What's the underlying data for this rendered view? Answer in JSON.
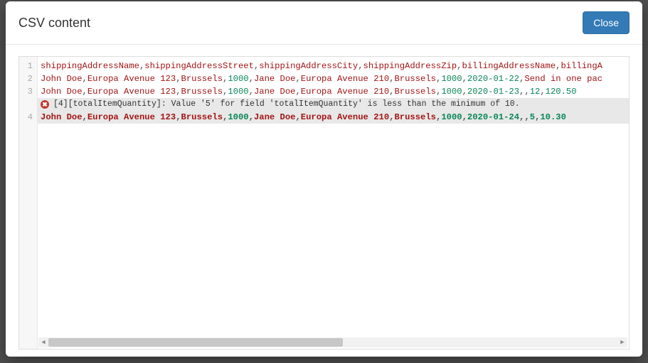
{
  "modal": {
    "title": "CSV content",
    "close_label": "Close"
  },
  "editor": {
    "lines": [
      {
        "n": 1,
        "kind": "text",
        "tokens": [
          {
            "t": "id",
            "v": "shippingAddressName"
          },
          {
            "t": "c",
            "v": ","
          },
          {
            "t": "id",
            "v": "shippingAddressStreet"
          },
          {
            "t": "c",
            "v": ","
          },
          {
            "t": "id",
            "v": "shippingAddressCity"
          },
          {
            "t": "c",
            "v": ","
          },
          {
            "t": "id",
            "v": "shippingAddressZip"
          },
          {
            "t": "c",
            "v": ","
          },
          {
            "t": "id",
            "v": "billingAddressName"
          },
          {
            "t": "c",
            "v": ","
          },
          {
            "t": "id",
            "v": "billingA"
          }
        ]
      },
      {
        "n": 2,
        "kind": "text",
        "tokens": [
          {
            "t": "str",
            "v": "John Doe"
          },
          {
            "t": "c",
            "v": ","
          },
          {
            "t": "str",
            "v": "Europa Avenue 123"
          },
          {
            "t": "c",
            "v": ","
          },
          {
            "t": "str",
            "v": "Brussels"
          },
          {
            "t": "c",
            "v": ","
          },
          {
            "t": "num",
            "v": "1000"
          },
          {
            "t": "c",
            "v": ","
          },
          {
            "t": "str",
            "v": "Jane Doe"
          },
          {
            "t": "c",
            "v": ","
          },
          {
            "t": "str",
            "v": "Europa Avenue 210"
          },
          {
            "t": "c",
            "v": ","
          },
          {
            "t": "str",
            "v": "Brussels"
          },
          {
            "t": "c",
            "v": ","
          },
          {
            "t": "num",
            "v": "1000"
          },
          {
            "t": "c",
            "v": ","
          },
          {
            "t": "num",
            "v": "2020-01-22"
          },
          {
            "t": "c",
            "v": ","
          },
          {
            "t": "str",
            "v": "Send in one pac"
          }
        ]
      },
      {
        "n": 3,
        "kind": "text",
        "tokens": [
          {
            "t": "str",
            "v": "John Doe"
          },
          {
            "t": "c",
            "v": ","
          },
          {
            "t": "str",
            "v": "Europa Avenue 123"
          },
          {
            "t": "c",
            "v": ","
          },
          {
            "t": "str",
            "v": "Brussels"
          },
          {
            "t": "c",
            "v": ","
          },
          {
            "t": "num",
            "v": "1000"
          },
          {
            "t": "c",
            "v": ","
          },
          {
            "t": "str",
            "v": "Jane Doe"
          },
          {
            "t": "c",
            "v": ","
          },
          {
            "t": "str",
            "v": "Europa Avenue 210"
          },
          {
            "t": "c",
            "v": ","
          },
          {
            "t": "str",
            "v": "Brussels"
          },
          {
            "t": "c",
            "v": ","
          },
          {
            "t": "num",
            "v": "1000"
          },
          {
            "t": "c",
            "v": ","
          },
          {
            "t": "num",
            "v": "2020-01-23"
          },
          {
            "t": "c",
            "v": ","
          },
          {
            "t": "c",
            "v": ","
          },
          {
            "t": "num",
            "v": "12"
          },
          {
            "t": "c",
            "v": ","
          },
          {
            "t": "num",
            "v": "120.50"
          }
        ]
      },
      {
        "kind": "error",
        "message": "[4][totalItemQuantity]: Value '5' for field 'totalItemQuantity' is less than the minimum of 10."
      },
      {
        "n": 4,
        "kind": "text",
        "highlight": true,
        "tokens": [
          {
            "t": "str",
            "v": "John Doe"
          },
          {
            "t": "c",
            "v": ","
          },
          {
            "t": "str",
            "v": "Europa Avenue 123"
          },
          {
            "t": "c",
            "v": ","
          },
          {
            "t": "str",
            "v": "Brussels"
          },
          {
            "t": "c",
            "v": ","
          },
          {
            "t": "num",
            "v": "1000"
          },
          {
            "t": "c",
            "v": ","
          },
          {
            "t": "str",
            "v": "Jane Doe"
          },
          {
            "t": "c",
            "v": ","
          },
          {
            "t": "str",
            "v": "Europa Avenue 210"
          },
          {
            "t": "c",
            "v": ","
          },
          {
            "t": "str",
            "v": "Brussels"
          },
          {
            "t": "c",
            "v": ","
          },
          {
            "t": "num",
            "v": "1000"
          },
          {
            "t": "c",
            "v": ","
          },
          {
            "t": "num",
            "v": "2020-01-24"
          },
          {
            "t": "c",
            "v": ","
          },
          {
            "t": "c",
            "v": ","
          },
          {
            "t": "num",
            "v": "5"
          },
          {
            "t": "c",
            "v": ","
          },
          {
            "t": "num",
            "v": "10.30"
          }
        ]
      }
    ],
    "scroll": {
      "left_glyph": "◀",
      "right_glyph": "▶"
    }
  }
}
